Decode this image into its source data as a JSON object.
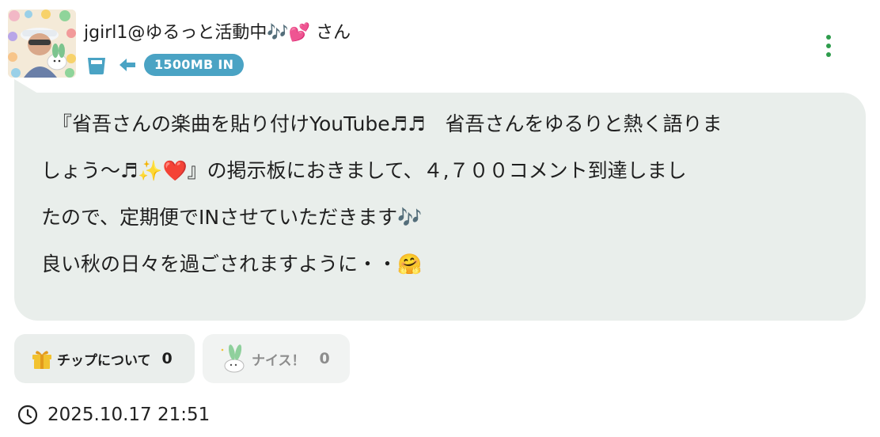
{
  "post": {
    "user": {
      "display_name": "jgirl1@ゆるっと活動中🎶💕 さん"
    },
    "badges": {
      "cup_icon": "cup-icon",
      "arrow_icon": "arrow-left-icon",
      "transfer_label": "1500MB IN",
      "accent_color": "#4aa3c4"
    },
    "menu_icon": "more-vertical-icon",
    "message": {
      "lines": [
        "『省吾さんの楽曲を貼り付けYouTube♬♬　省吾さんをゆるりと熱く語りま",
        "しょう〜♬✨❤️』の掲示板におきまして、４,７００コメント到達しまし",
        "たので、定期便でINさせていただきます🎶",
        "良い秋の日々を過ごされますように・・🤗"
      ]
    },
    "reactions": {
      "tip": {
        "icon": "gift-icon",
        "label": "チップについて",
        "count": "0"
      },
      "nice": {
        "icon": "bunny-mascot-icon",
        "label": "ナイス！",
        "count": "0"
      }
    },
    "timestamp": {
      "icon": "clock-icon",
      "value": "2025.10.17 21:51"
    }
  }
}
